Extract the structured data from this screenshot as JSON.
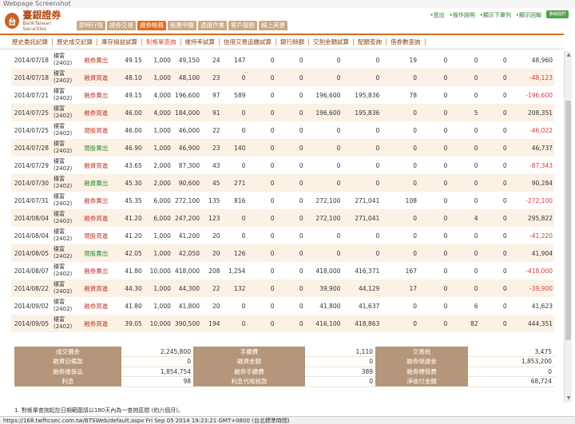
{
  "window": {
    "title": "Webpage Screenshot"
  },
  "logo": {
    "mark": "台",
    "name": "臺銀證券",
    "english": "BankTaiwan Securities"
  },
  "nav": {
    "tabs": [
      {
        "label": "即時行情",
        "active": false
      },
      {
        "label": "證券交易",
        "active": false
      },
      {
        "label": "證券帳務",
        "active": true
      },
      {
        "label": "股票申購",
        "active": false
      },
      {
        "label": "憑證作業",
        "active": false
      },
      {
        "label": "客戶服務",
        "active": false
      },
      {
        "label": "線上其書",
        "active": false
      }
    ]
  },
  "toplinks": [
    "•登出",
    "•操作說明",
    "•顯示下單列",
    "•顯示回報"
  ],
  "contact_button": "聯絡我們",
  "subnav": {
    "items": [
      {
        "label": "歷史委託記錄",
        "active": false
      },
      {
        "label": "歷史成交記錄",
        "active": false
      },
      {
        "label": "庫存損益試算",
        "active": false
      },
      {
        "label": "對帳單查詢",
        "active": true
      },
      {
        "label": "維持率試算",
        "active": false
      },
      {
        "label": "信用交易追繳試算",
        "active": false
      },
      {
        "label": "銀行餘額",
        "active": false
      },
      {
        "label": "交割金額試算",
        "active": false
      },
      {
        "label": "配額查詢",
        "active": false
      },
      {
        "label": "借券數查詢",
        "active": false
      }
    ]
  },
  "trades": [
    {
      "date": "2014/07/18",
      "name": "穩富",
      "code": "(2402)",
      "type": "融券賣出",
      "type_color": "red",
      "price": "49.15",
      "qty": "1,000",
      "amount": "49,150",
      "fee": "24",
      "tax": "147",
      "c1": "0",
      "c2": "0",
      "c3": "0",
      "c4": "0",
      "c5": "19",
      "c6": "0",
      "c7": "0",
      "c8": "0",
      "net": "48,960",
      "net_color": "black"
    },
    {
      "date": "2014/07/18",
      "name": "穩富",
      "code": "(2402)",
      "type": "融資買進",
      "type_color": "red",
      "price": "48.10",
      "qty": "1,000",
      "amount": "48,100",
      "fee": "23",
      "tax": "0",
      "c1": "0",
      "c2": "0",
      "c3": "0",
      "c4": "0",
      "c5": "0",
      "c6": "0",
      "c7": "0",
      "c8": "0",
      "net": "-48,123",
      "net_color": "neg"
    },
    {
      "date": "2014/07/21",
      "name": "穩富",
      "code": "(2402)",
      "type": "融券賣出",
      "type_color": "red",
      "price": "49.15",
      "qty": "4,000",
      "amount": "196,600",
      "fee": "97",
      "tax": "589",
      "c1": "0",
      "c2": "0",
      "c3": "196,600",
      "c4": "195,836",
      "c5": "78",
      "c6": "0",
      "c7": "0",
      "c8": "0",
      "net": "-196,600",
      "net_color": "neg"
    },
    {
      "date": "2014/07/25",
      "name": "穩富",
      "code": "(2402)",
      "type": "融券買進",
      "type_color": "red",
      "price": "46.00",
      "qty": "4,000",
      "amount": "184,000",
      "fee": "91",
      "tax": "0",
      "c1": "0",
      "c2": "0",
      "c3": "196,600",
      "c4": "195,836",
      "c5": "0",
      "c6": "0",
      "c7": "5",
      "c8": "0",
      "net": "208,351",
      "net_color": "black"
    },
    {
      "date": "2014/07/25",
      "name": "穩富",
      "code": "(2402)",
      "type": "現股買進",
      "type_color": "red",
      "price": "46.00",
      "qty": "1,000",
      "amount": "46,000",
      "fee": "22",
      "tax": "0",
      "c1": "0",
      "c2": "0",
      "c3": "0",
      "c4": "0",
      "c5": "0",
      "c6": "0",
      "c7": "0",
      "c8": "0",
      "net": "-46,022",
      "net_color": "neg"
    },
    {
      "date": "2014/07/28",
      "name": "穩富",
      "code": "(2402)",
      "type": "現股賣出",
      "type_color": "green",
      "price": "46.90",
      "qty": "1,000",
      "amount": "46,900",
      "fee": "23",
      "tax": "140",
      "c1": "0",
      "c2": "0",
      "c3": "0",
      "c4": "0",
      "c5": "0",
      "c6": "0",
      "c7": "0",
      "c8": "0",
      "net": "46,737",
      "net_color": "black"
    },
    {
      "date": "2014/07/29",
      "name": "穩富",
      "code": "(2402)",
      "type": "融資買進",
      "type_color": "red",
      "price": "43.65",
      "qty": "2,000",
      "amount": "87,300",
      "fee": "43",
      "tax": "0",
      "c1": "0",
      "c2": "0",
      "c3": "0",
      "c4": "0",
      "c5": "0",
      "c6": "0",
      "c7": "0",
      "c8": "0",
      "net": "-87,343",
      "net_color": "neg"
    },
    {
      "date": "2014/07/30",
      "name": "穩富",
      "code": "(2402)",
      "type": "融資賣出",
      "type_color": "green",
      "price": "45.30",
      "qty": "2,000",
      "amount": "90,600",
      "fee": "45",
      "tax": "271",
      "c1": "0",
      "c2": "0",
      "c3": "0",
      "c4": "0",
      "c5": "0",
      "c6": "0",
      "c7": "0",
      "c8": "0",
      "net": "90,284",
      "net_color": "black"
    },
    {
      "date": "2014/07/31",
      "name": "穩富",
      "code": "(2402)",
      "type": "融券賣出",
      "type_color": "red",
      "price": "45.35",
      "qty": "6,000",
      "amount": "272,100",
      "fee": "135",
      "tax": "816",
      "c1": "0",
      "c2": "0",
      "c3": "272,100",
      "c4": "271,041",
      "c5": "108",
      "c6": "0",
      "c7": "0",
      "c8": "0",
      "net": "-272,100",
      "net_color": "neg"
    },
    {
      "date": "2014/08/04",
      "name": "穩富",
      "code": "(2402)",
      "type": "融券買進",
      "type_color": "red",
      "price": "41.20",
      "qty": "6,000",
      "amount": "247,200",
      "fee": "123",
      "tax": "0",
      "c1": "0",
      "c2": "0",
      "c3": "272,100",
      "c4": "271,041",
      "c5": "0",
      "c6": "0",
      "c7": "4",
      "c8": "0",
      "net": "295,822",
      "net_color": "black"
    },
    {
      "date": "2014/08/04",
      "name": "穩富",
      "code": "(2402)",
      "type": "現股買進",
      "type_color": "red",
      "price": "41.20",
      "qty": "1,000",
      "amount": "41,200",
      "fee": "20",
      "tax": "0",
      "c1": "0",
      "c2": "0",
      "c3": "0",
      "c4": "0",
      "c5": "0",
      "c6": "0",
      "c7": "0",
      "c8": "0",
      "net": "-41,220",
      "net_color": "neg"
    },
    {
      "date": "2014/08/05",
      "name": "穩富",
      "code": "(2402)",
      "type": "現股賣出",
      "type_color": "green",
      "price": "42.05",
      "qty": "1,000",
      "amount": "42,050",
      "fee": "20",
      "tax": "126",
      "c1": "0",
      "c2": "0",
      "c3": "0",
      "c4": "0",
      "c5": "0",
      "c6": "0",
      "c7": "0",
      "c8": "0",
      "net": "41,904",
      "net_color": "black"
    },
    {
      "date": "2014/08/07",
      "name": "穩富",
      "code": "(2402)",
      "type": "融券賣出",
      "type_color": "red",
      "price": "41.80",
      "qty": "10,000",
      "amount": "418,000",
      "fee": "208",
      "tax": "1,254",
      "c1": "0",
      "c2": "0",
      "c3": "418,000",
      "c4": "416,371",
      "c5": "167",
      "c6": "0",
      "c7": "0",
      "c8": "0",
      "net": "-418,000",
      "net_color": "neg"
    },
    {
      "date": "2014/08/22",
      "name": "穩富",
      "code": "(2402)",
      "type": "融資買進",
      "type_color": "red",
      "price": "44.30",
      "qty": "1,000",
      "amount": "44,300",
      "fee": "22",
      "tax": "132",
      "c1": "0",
      "c2": "0",
      "c3": "39,900",
      "c4": "44,129",
      "c5": "17",
      "c6": "0",
      "c7": "0",
      "c8": "0",
      "net": "-39,900",
      "net_color": "neg"
    },
    {
      "date": "2014/09/02",
      "name": "穩富",
      "code": "(2402)",
      "type": "融券買進",
      "type_color": "red",
      "price": "41.80",
      "qty": "1,000",
      "amount": "41,800",
      "fee": "20",
      "tax": "0",
      "c1": "0",
      "c2": "0",
      "c3": "41,800",
      "c4": "41,637",
      "c5": "0",
      "c6": "0",
      "c7": "6",
      "c8": "0",
      "net": "41,623",
      "net_color": "black"
    },
    {
      "date": "2014/09/05",
      "name": "穩富",
      "code": "(2402)",
      "type": "融券買進",
      "type_color": "red",
      "price": "39.05",
      "qty": "10,000",
      "amount": "390,500",
      "fee": "194",
      "tax": "0",
      "c1": "0",
      "c2": "0",
      "c3": "416,100",
      "c4": "418,863",
      "c5": "0",
      "c6": "0",
      "c7": "82",
      "c8": "0",
      "net": "444,351",
      "net_color": "black"
    }
  ],
  "summary": {
    "rows": [
      [
        {
          "label": "成交價金",
          "value": "2,245,800"
        },
        {
          "label": "手續費",
          "value": "1,110"
        },
        {
          "label": "交易稅",
          "value": "3,475"
        }
      ],
      [
        {
          "label": "融資自備款",
          "value": "0"
        },
        {
          "label": "融資金額",
          "value": "0"
        },
        {
          "label": "融券保證金",
          "value": "1,853,200"
        }
      ],
      [
        {
          "label": "融券擔保品",
          "value": "1,854,754"
        },
        {
          "label": "融券手續費",
          "value": "389"
        },
        {
          "label": "融券標借費",
          "value": "0"
        }
      ],
      [
        {
          "label": "利息",
          "value": "98"
        },
        {
          "label": "利息代收稅款",
          "value": "0"
        },
        {
          "label": "淨收付金額",
          "value": "68,724"
        }
      ]
    ]
  },
  "footnote": "1. 對帳單查詢起訖日期範圍請以180天內為一查詢區間 (約六個月)。",
  "statusbar": "https://168.twfhcsec.com.tw/BTSWeb/default.aspx Fri Sep 05 2014 19:23:21 GMT+0800 (台北標準時間)"
}
